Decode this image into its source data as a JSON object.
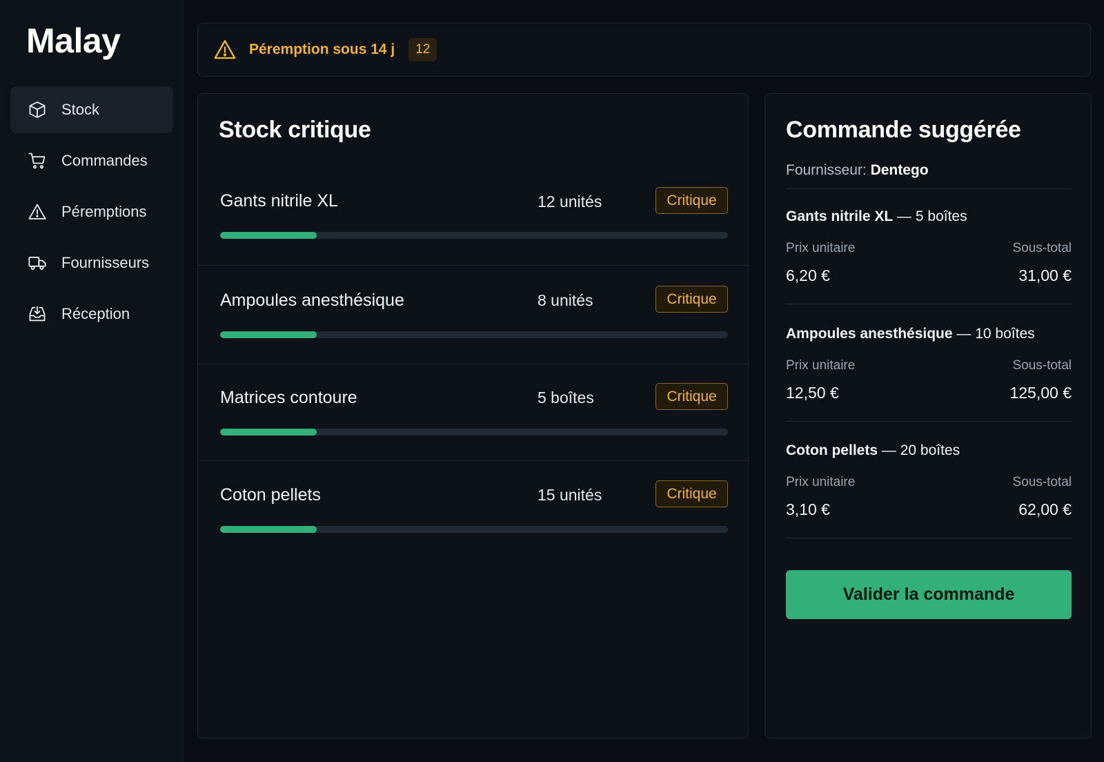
{
  "app": {
    "name": "Malay"
  },
  "sidebar": {
    "items": [
      {
        "label": "Stock",
        "icon": "box-icon",
        "active": true
      },
      {
        "label": "Commandes",
        "icon": "cart-icon",
        "active": false
      },
      {
        "label": "Péremptions",
        "icon": "warning-icon",
        "active": false
      },
      {
        "label": "Fournisseurs",
        "icon": "truck-icon",
        "active": false
      },
      {
        "label": "Réception",
        "icon": "inbox-download-icon",
        "active": false
      }
    ]
  },
  "alert": {
    "icon": "warning-icon",
    "text": "Péremption sous 14 j",
    "count": "12"
  },
  "stock_panel": {
    "title": "Stock critique",
    "items": [
      {
        "name": "Gants nitrile XL",
        "quantity": "12 unités",
        "badge": "Critique",
        "level": 0.19
      },
      {
        "name": "Ampoules anesthésique",
        "quantity": "8 unités",
        "badge": "Critique",
        "level": 0.19
      },
      {
        "name": "Matrices contoure",
        "quantity": "5 boîtes",
        "badge": "Critique",
        "level": 0.19
      },
      {
        "name": "Coton pellets",
        "quantity": "15 unités",
        "badge": "Critique",
        "level": 0.19
      }
    ]
  },
  "order_panel": {
    "title": "Commande suggérée",
    "supplier_label": "Fournisseur:",
    "supplier_name": "Dentego",
    "items": [
      {
        "name": "Gants nitrile XL",
        "quantity": "— 5 boîtes",
        "unit_price_label": "Prix unitaire",
        "subtotal_label": "Sous-total",
        "unit_price": "6,20 €",
        "subtotal": "31,00 €"
      },
      {
        "name": "Ampoules anesthésique",
        "quantity": "— 10 boîtes",
        "unit_price_label": "Prix unitaire",
        "subtotal_label": "Sous-total",
        "unit_price": "12,50 €",
        "subtotal": "125,00 €"
      },
      {
        "name": "Coton pellets",
        "quantity": "— 20 boîtes",
        "unit_price_label": "Prix unitaire",
        "subtotal_label": "Sous-total",
        "unit_price": "3,10 €",
        "subtotal": "62,00 €"
      }
    ],
    "validate_label": "Valider la commande"
  },
  "colors": {
    "background": "#0a0e14",
    "accent": "#33b07a",
    "warning": "#f0b43c"
  }
}
